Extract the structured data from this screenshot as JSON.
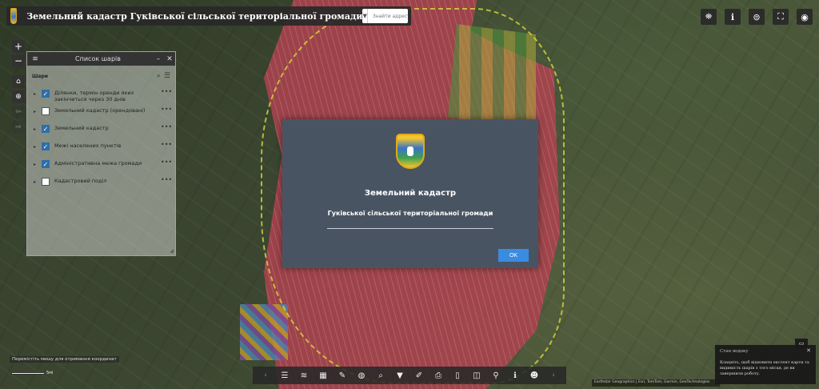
{
  "header": {
    "title": "Земельний кадастр Гуківської сільської територіальної громади",
    "search_placeholder": "Знайти адресу або кадастровий н",
    "search_caret": "▼",
    "search_icon": "search-icon"
  },
  "top_tools": [
    "layers-tool-icon",
    "info-icon",
    "measure-icon",
    "fullscreen-icon",
    "eye-icon"
  ],
  "zoom": {
    "in": "+",
    "out": "−"
  },
  "layers_panel": {
    "title": "Список шарів",
    "section_label": "Шари",
    "layers": [
      {
        "name": "Ділянки, термін оренди яких закінчиться через 30 днів",
        "checked": true
      },
      {
        "name": "Земельний кадастр (орендовані)",
        "checked": false
      },
      {
        "name": "Земельний кадастр",
        "checked": true
      },
      {
        "name": "Межі населених пунктів",
        "checked": true
      },
      {
        "name": "Адміністративна межа громади",
        "checked": true
      },
      {
        "name": "Кадастровий поділ",
        "checked": false
      }
    ]
  },
  "modal": {
    "title": "Земельний кадастр",
    "subtitle": "Гуківської сільської територіальної громади",
    "ok_label": "OK"
  },
  "bottom_toolbar": [
    "list-icon",
    "layers-icon",
    "grid-icon",
    "draw-icon",
    "palette-icon",
    "query-icon",
    "filter-icon",
    "edit-icon",
    "print-icon",
    "bookmark-icon",
    "swipe-icon",
    "locate-icon",
    "info-icon",
    "smile-icon"
  ],
  "coord_hint": "Перемістіть мишу для отримання координат",
  "scale_label": "5мі",
  "attribution": "Earthstar Geographics | Esri, TomTom, Garmin, GeoTechnologies",
  "tip": {
    "title": "Стан водоку",
    "text": "Клацніть, щоб відновити екстент карти та видимість шарів з того місця, де ви завершили роботу."
  }
}
